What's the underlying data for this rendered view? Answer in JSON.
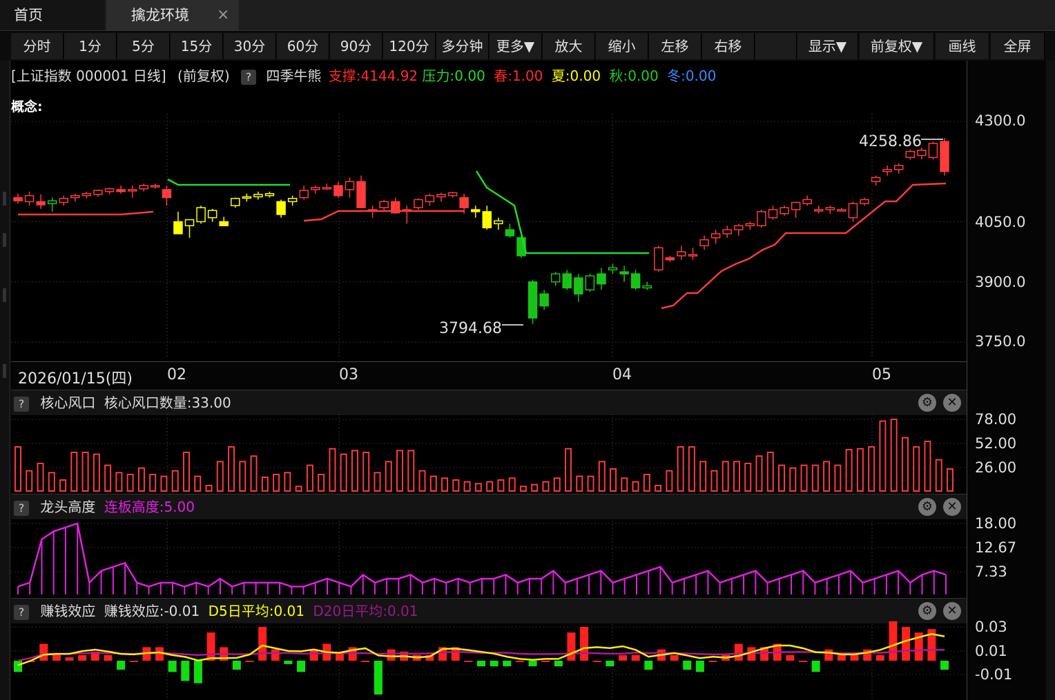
{
  "tabs": {
    "home": "首页",
    "active": "擒龙环境",
    "close_glyph": "×"
  },
  "toolbar": [
    "分时",
    "1分",
    "5分",
    "15分",
    "30分",
    "60分",
    "90分",
    "120分",
    "多分钟",
    "更多▼",
    "放大",
    "缩小",
    "左移",
    "右移",
    "",
    "显示▼",
    "前复权▼",
    "画线",
    "全屏"
  ],
  "info": {
    "title": "[上证指数 000001 日线]",
    "adjust": "(前复权)",
    "help": "?",
    "indicator": "四季牛熊",
    "support": "支撑:4144.92",
    "pressure": "压力:0.00",
    "spring": "春:1.00",
    "summer": "夏:0.00",
    "autumn": "秋:0.00",
    "winter": "冬:0.00",
    "concept": "概念:"
  },
  "colors": {
    "up": "#ff3b3b",
    "down": "#18c318",
    "yellow": "#ffff00",
    "magenta": "#e020e0",
    "green": "#22dd22",
    "blue": "#3a8aff"
  },
  "main_axis": {
    "labels": [
      "4300.0",
      "4050.0",
      "3900.0",
      "3750.0"
    ]
  },
  "annotations": {
    "high": "4258.86",
    "low": "3794.68"
  },
  "dates": {
    "start": "2026/01/15(四)",
    "months": [
      "02",
      "03",
      "04",
      "05"
    ]
  },
  "panels": {
    "core": {
      "help": "?",
      "name": "核心风口",
      "value": "核心风口数量:33.00",
      "axis": [
        "78.00",
        "52.00",
        "26.00"
      ]
    },
    "dragon": {
      "help": "?",
      "name": "龙头高度",
      "value": "连板高度:5.00",
      "axis": [
        "18.00",
        "12.67",
        "7.33"
      ]
    },
    "money": {
      "help": "?",
      "name": "赚钱效应",
      "value": "赚钱效应:-0.01",
      "d5": "D5日平均:0.01",
      "d20": "D20日平均:0.01",
      "axis": [
        "0.03",
        "0.01",
        "-0.01"
      ]
    }
  },
  "icons": {
    "settings": "gear-icon",
    "close": "close-icon",
    "help": "question-icon"
  },
  "chart_data": [
    {
      "type": "candlestick",
      "title": "上证指数 000001 日线",
      "ylim": [
        3700,
        4300
      ],
      "annotations": [
        {
          "text": "4258.86",
          "value": 4258.86
        },
        {
          "text": "3794.68",
          "value": 3794.68
        }
      ],
      "candles": [
        [
          4110,
          4120,
          4095,
          4102,
          "red"
        ],
        [
          4100,
          4125,
          4090,
          4115,
          "red"
        ],
        [
          4100,
          4118,
          4082,
          4092,
          "red"
        ],
        [
          4095,
          4110,
          4075,
          4102,
          "down-small"
        ],
        [
          4098,
          4115,
          4090,
          4108,
          "red"
        ],
        [
          4110,
          4120,
          4100,
          4115,
          "red"
        ],
        [
          4115,
          4125,
          4108,
          4120,
          "red"
        ],
        [
          4118,
          4130,
          4112,
          4128,
          "red"
        ],
        [
          4125,
          4135,
          4118,
          4132,
          "red"
        ],
        [
          4130,
          4140,
          4120,
          4125,
          "red"
        ],
        [
          4128,
          4140,
          4110,
          4130,
          "red"
        ],
        [
          4132,
          4145,
          4125,
          4140,
          "red"
        ],
        [
          4138,
          4145,
          4132,
          4140,
          "red"
        ],
        [
          4130,
          4140,
          4090,
          4110,
          "red"
        ],
        [
          4050,
          4075,
          4020,
          4020,
          "yellow"
        ],
        [
          4040,
          4055,
          4010,
          4055,
          "yellow"
        ],
        [
          4050,
          4090,
          4045,
          4085,
          "yellow"
        ],
        [
          4060,
          4082,
          4050,
          4078,
          "yellow"
        ],
        [
          4050,
          4062,
          4040,
          4040,
          "yellow"
        ],
        [
          4090,
          4110,
          4085,
          4108,
          "yellow"
        ],
        [
          4110,
          4120,
          4100,
          4112,
          "yellow"
        ],
        [
          4112,
          4125,
          4105,
          4118,
          "yellow"
        ],
        [
          4115,
          4125,
          4110,
          4120,
          "yellow"
        ],
        [
          4100,
          4105,
          4060,
          4068,
          "yellow"
        ],
        [
          4100,
          4115,
          4090,
          4108,
          "yellow"
        ],
        [
          4110,
          4140,
          4105,
          4128,
          "red"
        ],
        [
          4130,
          4140,
          4120,
          4135,
          "red"
        ],
        [
          4135,
          4145,
          4130,
          4135,
          "red"
        ],
        [
          4140,
          4150,
          4110,
          4115,
          "red"
        ],
        [
          4130,
          4160,
          4110,
          4150,
          "red"
        ],
        [
          4150,
          4165,
          4120,
          4085,
          "red"
        ],
        [
          4080,
          4090,
          4060,
          4080,
          "red"
        ],
        [
          4085,
          4105,
          4075,
          4100,
          "red"
        ],
        [
          4100,
          4110,
          4070,
          4072,
          "red"
        ],
        [
          4080,
          4090,
          4045,
          4080,
          "red"
        ],
        [
          4085,
          4108,
          4080,
          4105,
          "red"
        ],
        [
          4100,
          4120,
          4090,
          4115,
          "red"
        ],
        [
          4112,
          4122,
          4100,
          4118,
          "red"
        ],
        [
          4115,
          4125,
          4110,
          4122,
          "red"
        ],
        [
          4110,
          4120,
          4070,
          4085,
          "red"
        ],
        [
          4080,
          4090,
          4060,
          4075,
          "yellow"
        ],
        [
          4075,
          4090,
          4030,
          4035,
          "yellow"
        ],
        [
          4045,
          4060,
          4030,
          4052,
          "yellow"
        ],
        [
          4030,
          4045,
          4010,
          4015,
          "down"
        ],
        [
          4010,
          4015,
          3960,
          3965,
          "down"
        ],
        [
          3900,
          3905,
          3795,
          3810,
          "down"
        ],
        [
          3840,
          3880,
          3830,
          3870,
          "down"
        ],
        [
          3900,
          3925,
          3890,
          3920,
          "up-hollow"
        ],
        [
          3920,
          3930,
          3880,
          3885,
          "down"
        ],
        [
          3910,
          3920,
          3850,
          3870,
          "up-hollow"
        ],
        [
          3880,
          3920,
          3875,
          3915,
          "up-hollow"
        ],
        [
          3920,
          3935,
          3880,
          3895,
          "down"
        ],
        [
          3930,
          3945,
          3920,
          3935,
          "up-hollow"
        ],
        [
          3925,
          3940,
          3900,
          3920,
          "down"
        ],
        [
          3920,
          3930,
          3880,
          3885,
          "down"
        ],
        [
          3885,
          3900,
          3880,
          3890,
          "up-hollow"
        ],
        [
          3930,
          3990,
          3925,
          3985,
          "red"
        ],
        [
          3960,
          3965,
          3950,
          3955,
          "red"
        ],
        [
          3965,
          3990,
          3955,
          3975,
          "red"
        ],
        [
          3965,
          3985,
          3955,
          3968,
          "red"
        ],
        [
          3990,
          4015,
          3980,
          4005,
          "red"
        ],
        [
          4010,
          4030,
          3995,
          4020,
          "red"
        ],
        [
          4020,
          4040,
          4010,
          4030,
          "red"
        ],
        [
          4030,
          4045,
          4015,
          4040,
          "red"
        ],
        [
          4040,
          4050,
          4030,
          4045,
          "red"
        ],
        [
          4040,
          4080,
          4035,
          4075,
          "red"
        ],
        [
          4060,
          4090,
          4055,
          4080,
          "red"
        ],
        [
          4070,
          4090,
          4065,
          4085,
          "red"
        ],
        [
          4080,
          4100,
          4060,
          4098,
          "red"
        ],
        [
          4095,
          4115,
          4090,
          4105,
          "red"
        ],
        [
          4080,
          4090,
          4070,
          4080,
          "red"
        ],
        [
          4080,
          4090,
          4070,
          4085,
          "red"
        ],
        [
          4080,
          4085,
          4075,
          4080,
          "red"
        ],
        [
          4060,
          4100,
          4050,
          4095,
          "red"
        ],
        [
          4095,
          4110,
          4090,
          4105,
          "red"
        ],
        [
          4150,
          4165,
          4140,
          4160,
          "red"
        ],
        [
          4175,
          4190,
          4165,
          4180,
          "red"
        ],
        [
          4180,
          4195,
          4170,
          4190,
          "red"
        ],
        [
          4210,
          4230,
          4205,
          4225,
          "red"
        ],
        [
          4215,
          4235,
          4205,
          4228,
          "red"
        ],
        [
          4210,
          4250,
          4205,
          4245,
          "red"
        ],
        [
          4250,
          4258.86,
          4165,
          4175,
          "red"
        ]
      ]
    },
    {
      "type": "bar",
      "title": "核心风口",
      "ylim": [
        0,
        80
      ],
      "values": [
        48,
        22,
        30,
        20,
        12,
        42,
        42,
        40,
        28,
        20,
        18,
        25,
        18,
        16,
        22,
        42,
        16,
        6,
        32,
        48,
        32,
        38,
        15,
        18,
        20,
        5,
        28,
        18,
        46,
        40,
        44,
        42,
        20,
        32,
        44,
        44,
        22,
        16,
        14,
        12,
        10,
        8,
        10,
        12,
        14,
        5,
        7,
        10,
        14,
        46,
        16,
        16,
        32,
        24,
        14,
        10,
        18,
        6,
        22,
        48,
        48,
        32,
        22,
        32,
        32,
        30,
        38,
        42,
        28,
        25,
        28,
        28,
        32,
        28,
        45,
        46,
        48,
        76,
        78,
        58,
        48,
        54,
        34,
        24
      ]
    },
    {
      "type": "line",
      "title": "龙头高度",
      "ylim": [
        0,
        20
      ],
      "values": [
        2,
        3,
        14,
        16,
        17,
        18,
        3,
        6,
        7,
        8,
        3,
        2,
        3,
        3,
        2,
        3,
        2,
        4,
        2,
        3,
        3,
        3,
        3,
        2,
        2,
        3,
        4,
        3,
        2,
        5,
        3,
        4,
        4,
        5,
        3,
        4,
        3,
        4,
        3,
        4,
        4,
        5,
        3,
        4,
        4,
        6,
        3,
        4,
        5,
        6,
        3,
        4,
        5,
        6,
        7,
        3,
        4,
        5,
        6,
        3,
        4,
        5,
        6,
        3,
        4,
        5,
        6,
        3,
        4,
        5,
        6,
        3,
        4,
        5,
        6,
        3,
        5,
        6,
        5
      ]
    },
    {
      "type": "bar",
      "title": "赚钱效应",
      "ylim": [
        -0.03,
        0.04
      ],
      "values": [
        -0.01,
        0.0,
        0.015,
        0.005,
        0.003,
        0.005,
        0.008,
        0.005,
        -0.008,
        0.0,
        0.012,
        0.012,
        -0.01,
        -0.018,
        -0.02,
        0.025,
        0.012,
        -0.008,
        0.0,
        0.03,
        0.01,
        -0.003,
        -0.01,
        0.01,
        0.015,
        0.007,
        0.012,
        0.0,
        -0.03,
        0.01,
        0.008,
        0.005,
        0.005,
        0.012,
        0.012,
        0.0,
        -0.005,
        -0.005,
        -0.005,
        0.0,
        -0.005,
        0.0,
        -0.005,
        0.025,
        0.03,
        0.0,
        -0.005,
        0.005,
        0.005,
        -0.008,
        0.01,
        0.005,
        -0.008,
        -0.01,
        0.0,
        0.005,
        0.015,
        0.012,
        0.012,
        0.015,
        0.005,
        0.0,
        -0.01,
        0.01,
        0.005,
        0.005,
        0.01,
        0.005,
        0.035,
        0.03,
        0.025,
        0.028,
        -0.008
      ]
    }
  ]
}
